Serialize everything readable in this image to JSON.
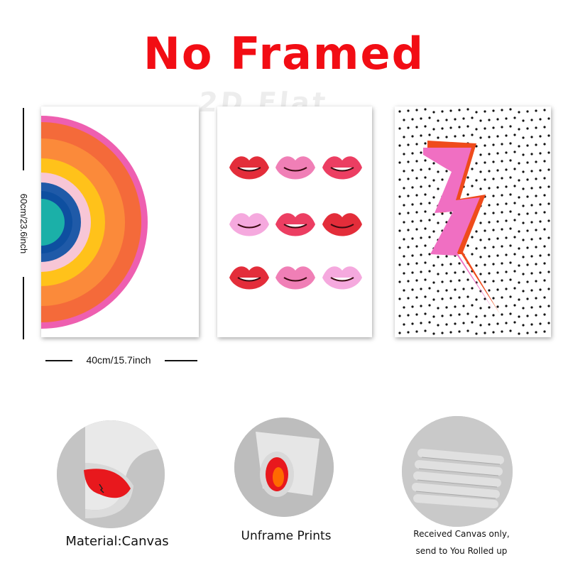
{
  "header": {
    "title": "No Framed",
    "watermark": "2D Flat"
  },
  "dimensions": {
    "height_label": "60cm/23.6inch",
    "width_label": "40cm/15.7inch"
  },
  "prints": [
    {
      "subject": "rainbow-arc",
      "colors": [
        "#ee5fb0",
        "#f26a2e",
        "#fb8a3a",
        "#ffc21a",
        "#f7c6d6",
        "#1f5aa8",
        "#1bb0a8"
      ]
    },
    {
      "subject": "lips-grid",
      "colors": [
        "#e32d3a",
        "#f07fb6",
        "#ec3e62",
        "#f5a9de"
      ]
    },
    {
      "subject": "lightning-bolt-polka-dots",
      "colors": [
        "#f06fc2",
        "#ef4b1b",
        "#111111"
      ]
    }
  ],
  "features": [
    {
      "name": "material",
      "caption": "Material:Canvas"
    },
    {
      "name": "unframe",
      "caption": "Unframe  Prints"
    },
    {
      "name": "rolled",
      "caption_line1": "Received Canvas only,",
      "caption_line2": "send to You Rolled up"
    }
  ],
  "colors": {
    "title_red": "#f20d14",
    "canvas_red": "#e8181d",
    "canvas_grey": "#bdbdbd"
  }
}
